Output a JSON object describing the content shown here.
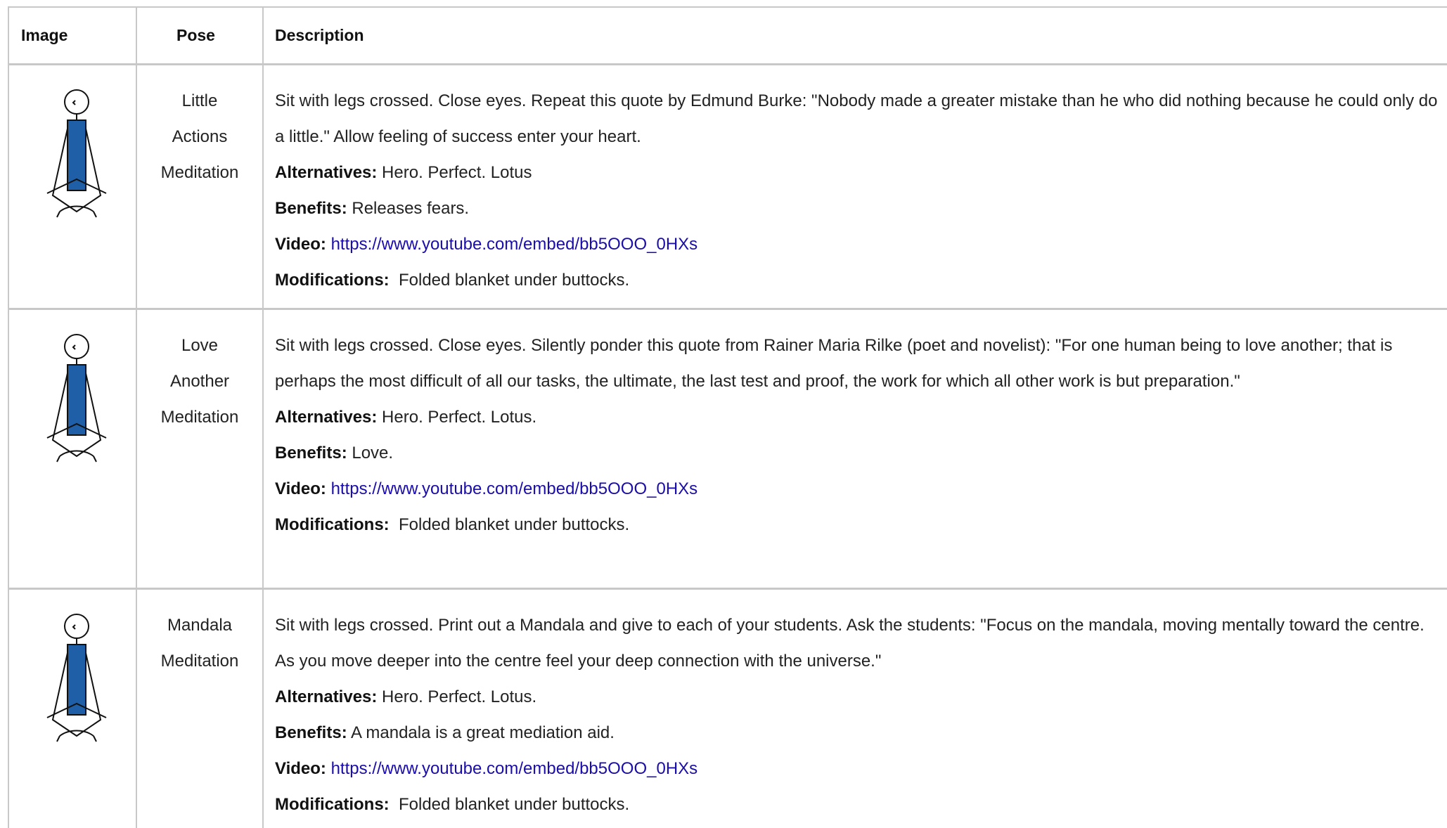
{
  "header": {
    "image": "Image",
    "pose": "Pose",
    "description": "Description"
  },
  "rows": [
    {
      "pose_lines": [
        "Little",
        "Actions",
        "Meditation"
      ],
      "description": "Sit with legs crossed. Close eyes. Repeat this quote by Edmund Burke: \"Nobody made a greater mistake than he who did nothing because he could only do a little.\" Allow feeling of success enter your heart.",
      "alternatives_label": "Alternatives:",
      "alternatives": " Hero. Perfect. Lotus",
      "benefits_label": "Benefits:",
      "benefits": " Releases fears.",
      "video_label": "Video:",
      "video": "https://www.youtube.com/embed/bb5OOO_0HXs",
      "modifications_label": "Modifications:",
      "modifications": "  Folded blanket under buttocks."
    },
    {
      "pose_lines": [
        "Love",
        "Another",
        "Meditation"
      ],
      "description": "Sit with legs crossed. Close eyes. Silently ponder this quote from Rainer Maria Rilke (poet and novelist): \"For one human being to love another; that is perhaps the most difficult of all our tasks, the ultimate, the last test and proof, the work for which all other work is but preparation.\"",
      "alternatives_label": "Alternatives:",
      "alternatives": " Hero. Perfect. Lotus.",
      "benefits_label": "Benefits:",
      "benefits": " Love.",
      "video_label": "Video:",
      "video": "https://www.youtube.com/embed/bb5OOO_0HXs",
      "modifications_label": "Modifications:",
      "modifications": "  Folded blanket under buttocks."
    },
    {
      "pose_lines": [
        "Mandala",
        "Meditation"
      ],
      "description": "Sit with legs crossed. Print out a Mandala and give to each of your students. Ask the students: \"Focus on the mandala, moving mentally toward the centre. As you move deeper into the centre feel your deep connection with the universe.\"",
      "alternatives_label": "Alternatives:",
      "alternatives": " Hero. Perfect. Lotus.",
      "benefits_label": "Benefits:",
      "benefits": " A mandala is a great mediation aid.",
      "video_label": "Video:",
      "video": "https://www.youtube.com/embed/bb5OOO_0HXs",
      "modifications_label": "Modifications:",
      "modifications": "  Folded blanket under buttocks."
    }
  ],
  "colors": {
    "border": "#c8c8c8",
    "link": "#1a0dab",
    "figure_body": "#1f5fa8"
  }
}
